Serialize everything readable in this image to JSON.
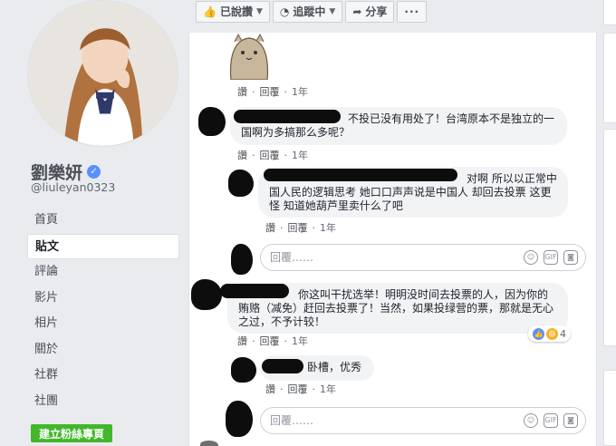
{
  "profile": {
    "name": "劉樂妍",
    "handle": "@liuleyan0323"
  },
  "nav": {
    "items": [
      {
        "label": "首頁"
      },
      {
        "label": "貼文"
      },
      {
        "label": "評論"
      },
      {
        "label": "影片"
      },
      {
        "label": "相片"
      },
      {
        "label": "關於"
      },
      {
        "label": "社群"
      },
      {
        "label": "社團"
      }
    ],
    "active_index": 1,
    "create_fan_page": "建立粉絲專頁"
  },
  "actions": {
    "liked": "已說讚",
    "following": "追蹤中",
    "share": "分享",
    "more": "···"
  },
  "comments": [
    {
      "text": "",
      "like": "讚",
      "reply": "回覆",
      "age": "1年"
    },
    {
      "text": "不投已没有用处了！台湾原本不是独立的一国啊为多搞那么多呢？",
      "like": "讚",
      "reply": "回覆",
      "age": "1年"
    },
    {
      "text": "对啊 所以以正常中国人民的逻辑思考 她口口声声说是中国人 却回去投票 这更怪 知道她葫芦里卖什么了吧",
      "like": "讚",
      "reply": "回覆",
      "age": "1年"
    },
    {
      "text": "你这叫干扰选举！明明没时间去投票的人，因为你的贿赂（减免）赶回去投票了！当然，如果投绿营的票，那就是无心之过，不予计较！",
      "like": "讚",
      "reply": "回覆",
      "age": "1年",
      "reaction_count": "4"
    },
    {
      "text": "卧槽，优秀",
      "like": "讚",
      "reply": "回覆",
      "age": "1年"
    }
  ],
  "reply_placeholder": "回覆……",
  "reply_icons": {
    "gif": "GIF"
  },
  "colors": {
    "verified": "#5890ff",
    "create_button": "#42b72a",
    "like_blue": "#5890ff",
    "haha_yellow": "#f7b125"
  }
}
